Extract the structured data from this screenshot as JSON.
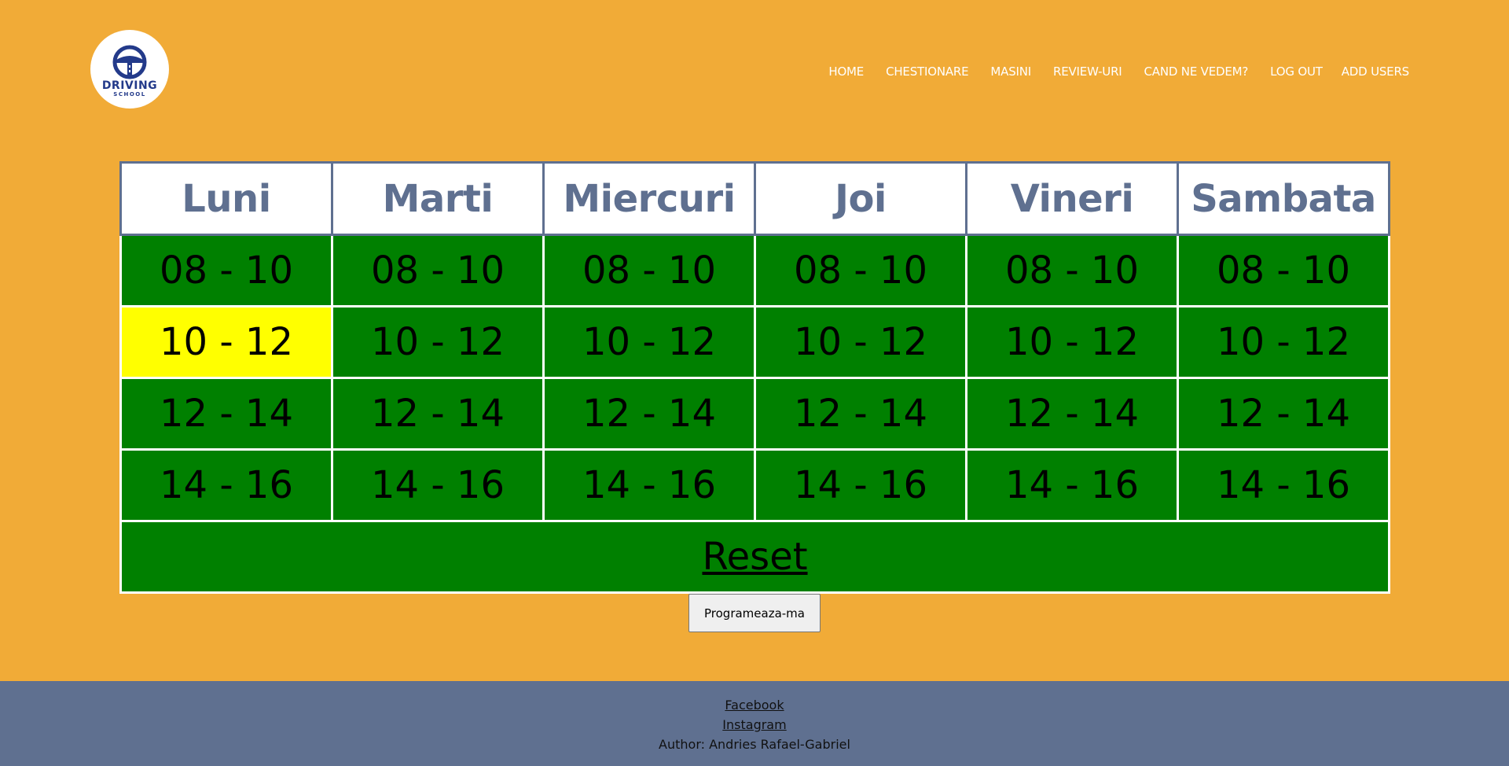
{
  "logo": {
    "title": "DRIVING",
    "subtitle": "SCHOOL",
    "icon": "steering-wheel-road-icon"
  },
  "nav": {
    "items": [
      "HOME",
      "CHESTIONARE",
      "MASINI",
      "REVIEW-URI",
      "CAND NE VEDEM?",
      "LOG OUT",
      "ADD USERS"
    ]
  },
  "schedule": {
    "days": [
      "Luni",
      "Marti",
      "Miercuri",
      "Joi",
      "Vineri",
      "Sambata"
    ],
    "slots": [
      "08 - 10",
      "10 - 12",
      "12 - 14",
      "14 - 16"
    ],
    "selected": {
      "day": "Luni",
      "slot": "10 - 12"
    },
    "reset_label": "Reset"
  },
  "submit_label": "Programeaza-ma",
  "footer": {
    "facebook": "Facebook",
    "instagram": "Instagram",
    "author": "Author: Andries Rafael-Gabriel"
  },
  "colors": {
    "background": "#f1ab37",
    "header_text": "#5f7090",
    "available": "#008000",
    "selected": "#ffff00",
    "footer": "#5f7090"
  }
}
